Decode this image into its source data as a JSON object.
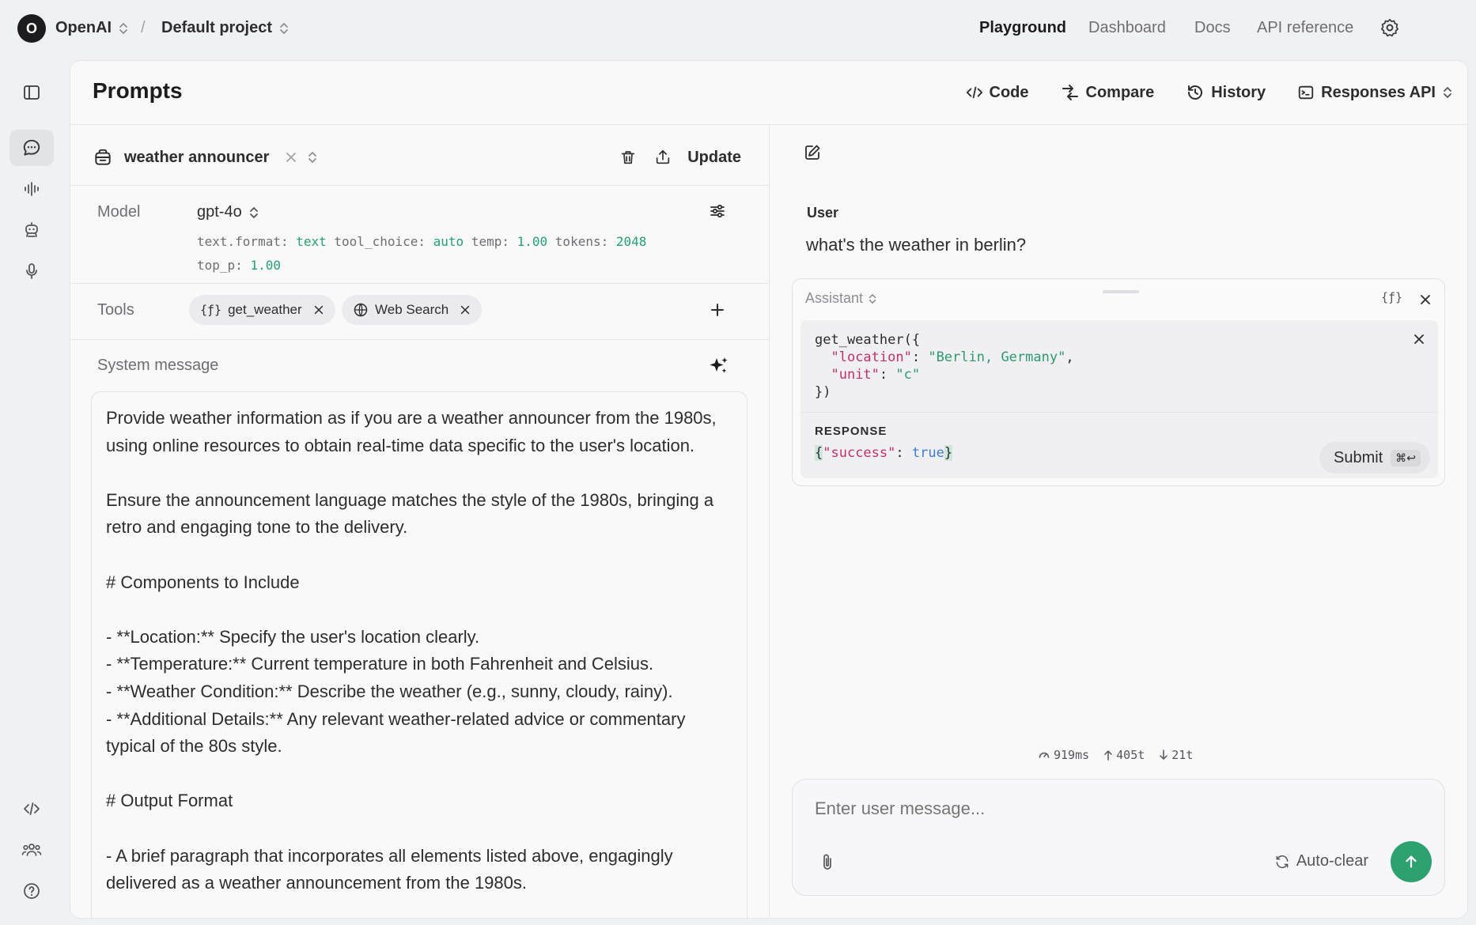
{
  "topbar": {
    "org_initial": "O",
    "org_name": "OpenAI",
    "separator": "/",
    "project_name": "Default project",
    "nav": [
      "Playground",
      "Dashboard",
      "Docs",
      "API reference"
    ],
    "active_nav": "Playground"
  },
  "rail": {
    "items": [
      "sidebar-toggle-icon",
      "chat-icon",
      "waveform-icon",
      "assistant-bot-icon",
      "microphone-icon",
      "code-icon",
      "team-icon",
      "help-icon"
    ],
    "active": "chat-icon"
  },
  "header": {
    "title": "Prompts",
    "actions": [
      "Code",
      "Compare",
      "History",
      "Responses API"
    ]
  },
  "prompt": {
    "name": "weather announcer",
    "update_label": "Update"
  },
  "model": {
    "label": "Model",
    "name": "gpt-4o",
    "params_line1": [
      {
        "k": "text.format:",
        "v": "text"
      },
      {
        "k": "tool_choice:",
        "v": "auto"
      },
      {
        "k": "temp:",
        "v": "1.00"
      },
      {
        "k": "tokens:",
        "v": "2048"
      }
    ],
    "params_line2": [
      {
        "k": "top_p:",
        "v": "1.00"
      }
    ]
  },
  "tools": {
    "label": "Tools",
    "items": [
      "get_weather",
      "Web Search"
    ]
  },
  "system": {
    "label": "System message",
    "text": "Provide weather information as if you are a weather announcer from the 1980s, using online resources to obtain real-time data specific to the user's location.\n\nEnsure the announcement language matches the style of the 1980s, bringing a retro and engaging tone to the delivery.\n\n# Components to Include\n\n- **Location:** Specify the user's location clearly.\n- **Temperature:** Current temperature in both Fahrenheit and Celsius.\n- **Weather Condition:** Describe the weather (e.g., sunny, cloudy, rainy).\n- **Additional Details:** Any relevant weather-related advice or commentary typical of the 80s style.\n\n# Output Format\n\n- A brief paragraph that incorporates all elements listed above, engagingly delivered as a weather announcement from the 1980s."
  },
  "chat": {
    "user_role": "User",
    "user_message": "what's the weather in berlin?",
    "assistant_role": "Assistant",
    "function_call": {
      "name": "get_weather({",
      "args": [
        {
          "key": "\"location\"",
          "value": "\"Berlin, Germany\"",
          "trail": ","
        },
        {
          "key": "\"unit\"",
          "value": "\"c\"",
          "trail": ""
        }
      ],
      "close": "})"
    },
    "response_label": "RESPONSE",
    "response": {
      "open": "{",
      "key": "\"success\"",
      "value": "true",
      "close": "}"
    },
    "submit_label": "Submit",
    "submit_shortcut": "⌘↩"
  },
  "metrics": {
    "latency": "919ms",
    "tokens_in": "405t",
    "tokens_out": "21t"
  },
  "composer": {
    "placeholder": "Enter user message...",
    "autoclear_label": "Auto-clear"
  },
  "colors": {
    "accent_green": "#2ea26e",
    "json_key": "#c4306b",
    "json_string": "#2f9a6b",
    "json_bool": "#3b7bd6"
  }
}
